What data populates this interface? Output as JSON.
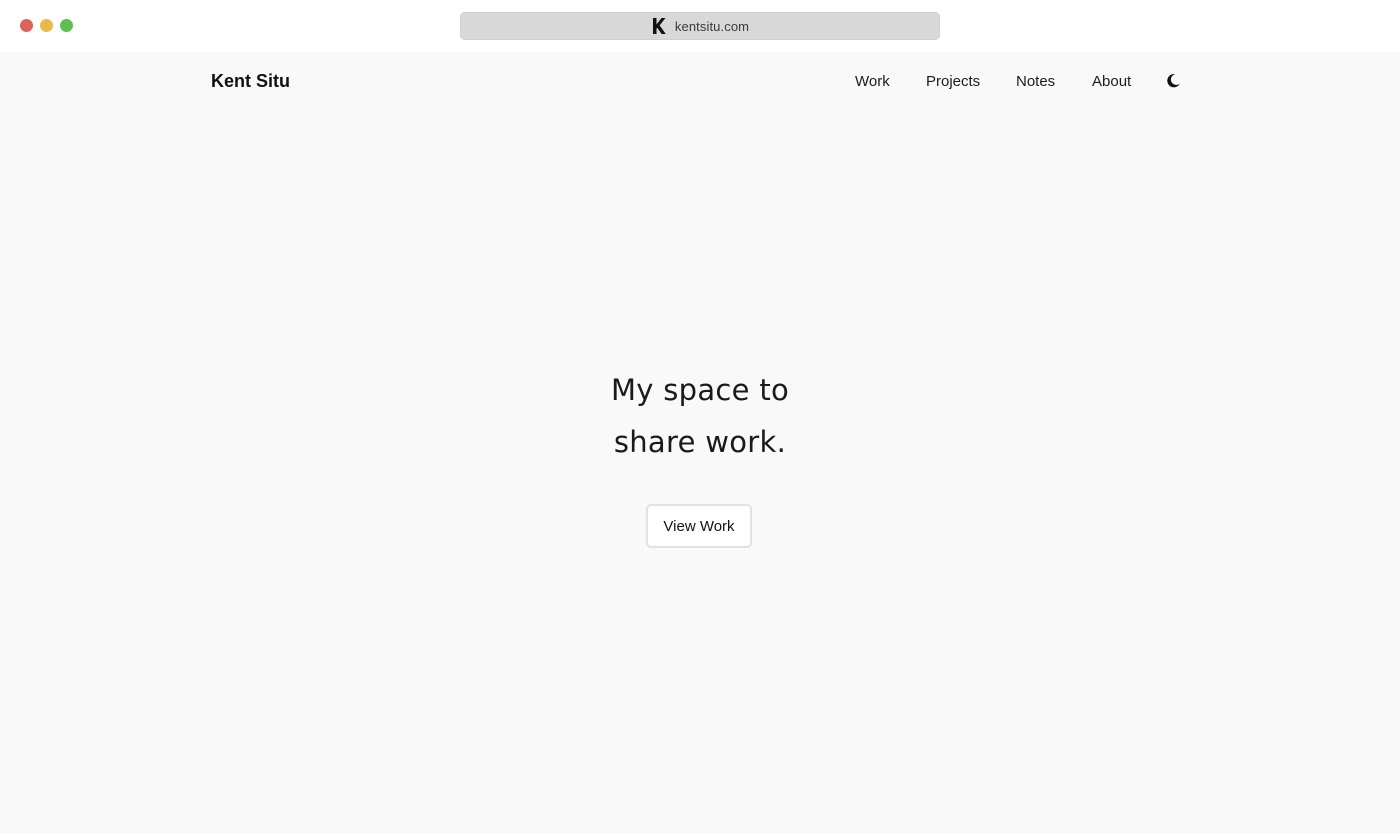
{
  "browser": {
    "url": "kentsitu.com",
    "favicon": "kentsitu-logo-icon"
  },
  "header": {
    "brand": "Kent Situ",
    "nav": [
      "Work",
      "Projects",
      "Notes",
      "About"
    ],
    "theme_toggle_icon": "moon-icon"
  },
  "hero": {
    "line1": "My space to",
    "line2": "share work.",
    "cta_label": "View Work"
  },
  "colors": {
    "page_background": "#f9f9f9",
    "text": "#1a1a1a",
    "traffic_close": "#e0605a",
    "traffic_minimize": "#e9b949",
    "traffic_maximize": "#5cc152"
  }
}
